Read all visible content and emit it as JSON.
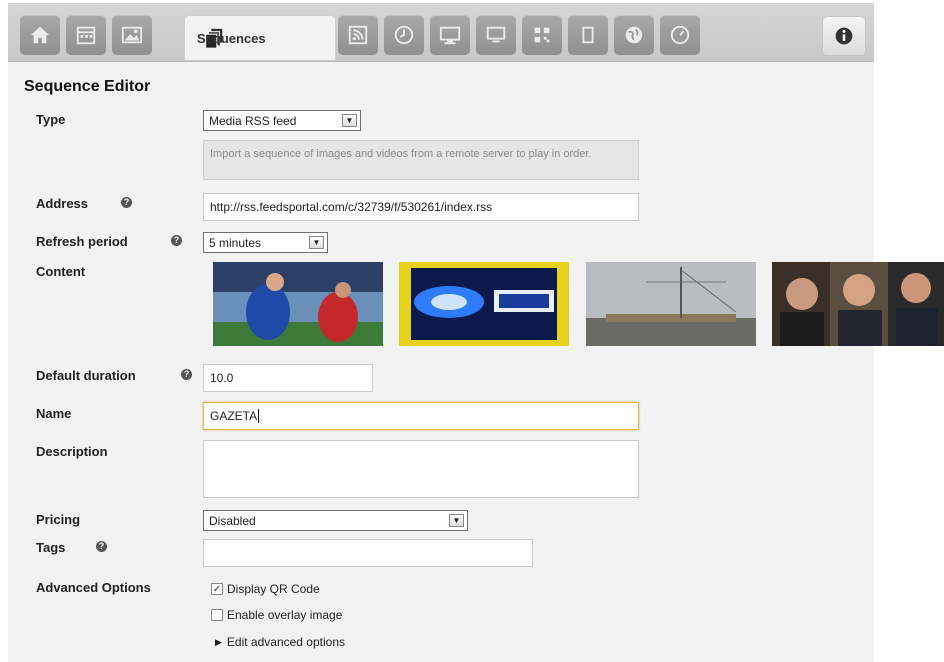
{
  "toolbar": {
    "active_tab_label": "Sequences",
    "buttons": [
      "home-icon",
      "calendar-icon",
      "image-icon",
      "rss-icon",
      "clock-icon",
      "monitor-icon",
      "qr-icon",
      "film-icon",
      "globe-icon",
      "gauge-icon"
    ]
  },
  "editor": {
    "title": "Sequence Editor",
    "type_label": "Type",
    "type_value": "Media RSS feed",
    "type_hint": "Import a sequence of images and videos from a remote server to play in order.",
    "address_label": "Address",
    "address_value": "http://rss.feedsportal.com/c/32739/f/530261/index.rss",
    "refresh_label": "Refresh period",
    "refresh_value": "5 minutes",
    "content_label": "Content",
    "duration_label": "Default duration",
    "duration_value": "10.0",
    "name_label": "Name",
    "name_value": "GAZETA",
    "description_label": "Description",
    "description_value": "",
    "pricing_label": "Pricing",
    "pricing_value": "Disabled",
    "tags_label": "Tags",
    "tags_value": "",
    "advanced_label": "Advanced Options",
    "display_qr_label": "Display QR Code",
    "display_qr_checked": true,
    "overlay_label": "Enable overlay image",
    "overlay_checked": false,
    "edit_advanced_label": "Edit advanced options"
  },
  "colors": {
    "toolbar_bg": "#c8c8c8",
    "panel_bg": "#f2f2f2",
    "name_focus_border": "#e8b552"
  }
}
